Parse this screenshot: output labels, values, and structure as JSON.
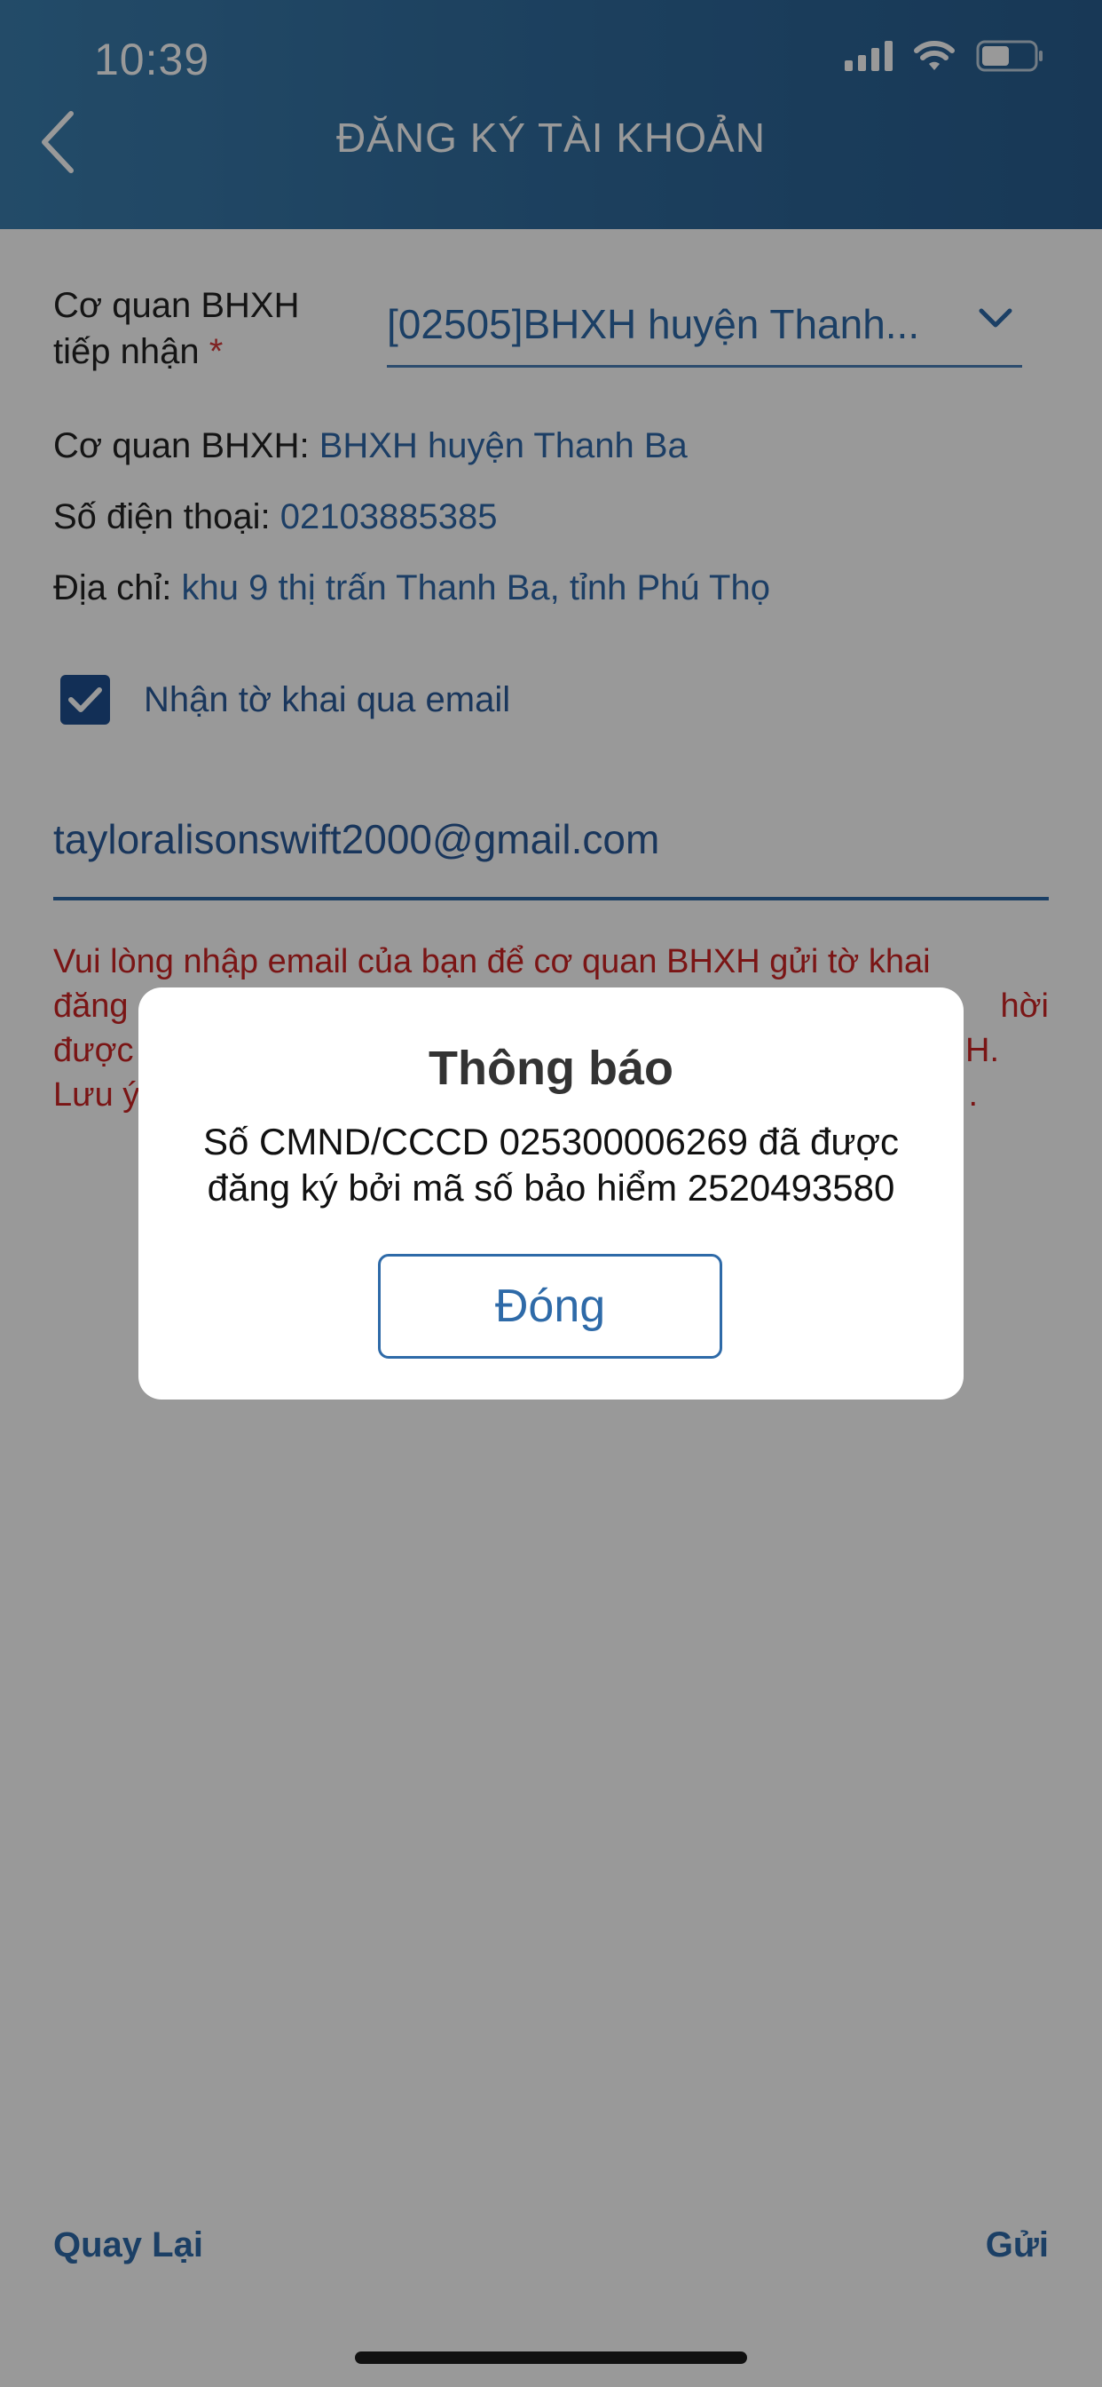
{
  "status_bar": {
    "time": "10:39",
    "icons": [
      "signal-icon",
      "wifi-icon",
      "battery-icon"
    ]
  },
  "header": {
    "title": "ĐĂNG KÝ TÀI KHOẢN",
    "back_icon": "chevron-left-icon"
  },
  "form": {
    "agency_label_line1": "Cơ quan BHXH",
    "agency_label_line2": "tiếp nhận",
    "required_mark": "*",
    "agency_selected": "[02505]BHXH huyện Thanh...",
    "agency_name_label": "Cơ quan BHXH:",
    "agency_name_value": "BHXH huyện Thanh Ba",
    "phone_label": "Số điện thoại:",
    "phone_value": "02103885385",
    "address_label": "Địa chỉ:",
    "address_value": "khu 9 thị trấn Thanh Ba, tỉnh Phú Thọ",
    "email_checkbox_label": "Nhận tờ khai qua email",
    "email_checkbox_checked": true,
    "email_value": "tayloralisonswift2000@gmail.com",
    "warning_line1": "Vui lòng nhập email của bạn để cơ quan BHXH gửi tờ khai",
    "warning_line2": "đăng",
    "warning_line2_end": "hời",
    "warning_line3": "được",
    "warning_line3_end": "H.",
    "warning_line4": "Lưu ý",
    "warning_line4_end": "."
  },
  "footer": {
    "back_label": "Quay Lại",
    "send_label": "Gửi"
  },
  "dialog": {
    "title": "Thông báo",
    "message_line1": "Số CMND/CCCD 025300006269 đã được",
    "message_line2": "đăng ký bởi mã số bảo hiểm 2520493580",
    "close_label": "Đóng"
  },
  "colors": {
    "header_bg": "#2f6a9c",
    "accent": "#2e6aa8",
    "warning": "#cc2323",
    "overlay": "rgba(0,0,0,0.40)"
  }
}
